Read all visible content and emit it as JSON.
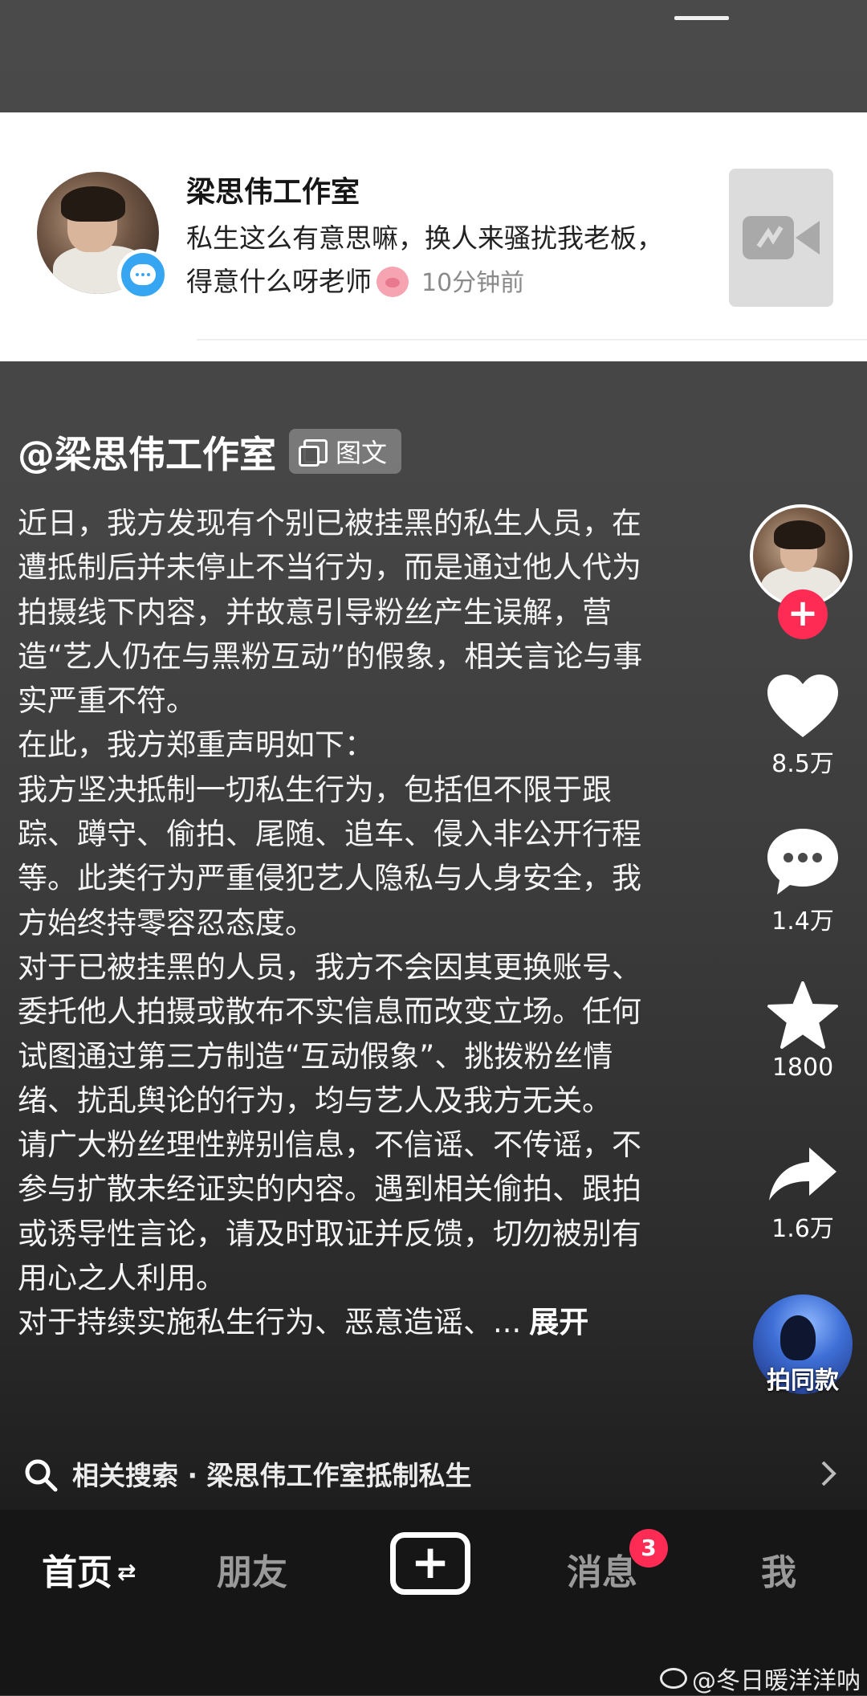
{
  "notification": {
    "sender": "梁思伟工作室",
    "message": "私生这么有意思嘛，换人来骚扰我老板，得意什么呀老师",
    "emoji": "pig-face",
    "time": "10分钟前"
  },
  "post": {
    "author": "@梁思伟工作室",
    "tag": "图文",
    "paragraphs": [
      "近日，我方发现有个别已被挂黑的私生人员，在遭抵制后并未停止不当行为，而是通过他人代为拍摄线下内容，并故意引导粉丝产生误解，营造“艺人仍在与黑粉互动”的假象，相关言论与事实严重不符。",
      "在此，我方郑重声明如下：",
      "我方坚决抵制一切私生行为，包括但不限于跟踪、蹲守、偷拍、尾随、追车、侵入非公开行程等。此类行为严重侵犯艺人隐私与人身安全，我方始终持零容忍态度。",
      "对于已被挂黑的人员，我方不会因其更换账号、委托他人拍摄或散布不实信息而改变立场。任何试图通过第三方制造“互动假象”、挑拨粉丝情绪、扰乱舆论的行为，均与艺人及我方无关。",
      "请广大粉丝理性辨别信息，不信谣、不传谣，不参与扩散未经证实的内容。遇到相关偷拍、跟拍或诱导性言论，请及时取证并反馈，切勿被别有用心之人利用。",
      "对于持续实施私生行为、恶意造谣、..."
    ],
    "expand_label": "展开"
  },
  "rail": {
    "likes": "8.5万",
    "comments": "1.4万",
    "favorites": "1800",
    "shares": "1.6万",
    "same_style_label": "拍同款",
    "follow_symbol": "+"
  },
  "related_search": "相关搜索 · 梁思伟工作室抵制私生",
  "tabbar": {
    "home": "首页",
    "home_arrows": "⇄",
    "friends": "朋友",
    "post_symbol": "+",
    "messages": "消息",
    "messages_badge": "3",
    "me": "我"
  },
  "watermark": "@冬日暖洋洋呐",
  "colors": {
    "accent": "#fe2c55",
    "message_badge": "#37a6f2"
  }
}
